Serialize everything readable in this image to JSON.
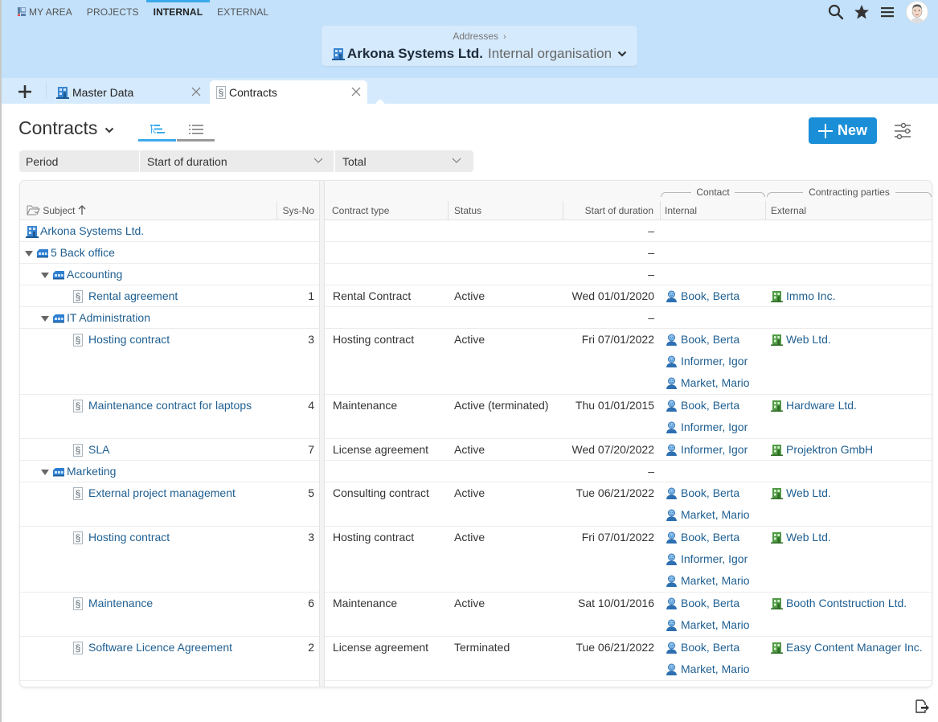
{
  "main_nav": [
    {
      "label": "MY AREA",
      "icon": "my-area-icon"
    },
    {
      "label": "PROJECTS"
    },
    {
      "label": "INTERNAL",
      "active": true
    },
    {
      "label": "EXTERNAL"
    }
  ],
  "tools": {
    "search": "search-icon",
    "favorites": "star-icon",
    "menu": "menu-icon",
    "avatar": "user-avatar"
  },
  "breadcrumb": {
    "parent": "Addresses",
    "separator": "›",
    "org_name": "Arkona Systems Ltd.",
    "org_type": "Internal organisation"
  },
  "tabs": [
    {
      "label": "Master Data",
      "icon": "building-icon"
    },
    {
      "label": "Contracts",
      "icon": "paragraph-icon",
      "active": true
    }
  ],
  "page": {
    "title": "Contracts",
    "new_label": "New"
  },
  "view_modes": [
    {
      "name": "tree-view",
      "active": true
    },
    {
      "name": "list-view",
      "active": false
    }
  ],
  "filters": {
    "period_label": "Period",
    "period_value": "Start of duration",
    "range_value": "Total"
  },
  "columns": {
    "subject": "Subject",
    "sys_no": "Sys-No",
    "contract_type": "Contract type",
    "status": "Status",
    "start": "Start of duration",
    "internal": "Internal",
    "external": "External",
    "group_contact": "Contact",
    "group_parties": "Contracting parties"
  },
  "rows": [
    {
      "kind": "org",
      "level": 0,
      "subject": "Arkona Systems Ltd.",
      "start": "–"
    },
    {
      "kind": "unit",
      "level": 1,
      "subject": "5 Back office",
      "start": "–"
    },
    {
      "kind": "unit",
      "level": 2,
      "subject": "Accounting",
      "start": "–"
    },
    {
      "kind": "contract",
      "level": 3,
      "subject": "Rental agreement",
      "sys_no": "1",
      "type": "Rental Contract",
      "status": "Active",
      "start": "Wed 01/01/2020",
      "internal": [
        "Book, Berta"
      ],
      "external": [
        "Immo Inc."
      ]
    },
    {
      "kind": "unit",
      "level": 2,
      "subject": "IT Administration",
      "start": "–"
    },
    {
      "kind": "contract",
      "level": 3,
      "subject": "Hosting contract",
      "sys_no": "3",
      "type": "Hosting contract",
      "status": "Active",
      "start": "Fri 07/01/2022",
      "internal": [
        "Book, Berta",
        "Informer, Igor",
        "Market, Mario"
      ],
      "external": [
        "Web Ltd."
      ]
    },
    {
      "kind": "contract",
      "level": 3,
      "subject": "Maintenance contract for laptops",
      "sys_no": "4",
      "type": "Maintenance",
      "status": "Active (terminated)",
      "start": "Thu 01/01/2015",
      "internal": [
        "Book, Berta",
        "Informer, Igor"
      ],
      "external": [
        "Hardware Ltd."
      ]
    },
    {
      "kind": "contract",
      "level": 3,
      "subject": "SLA",
      "sys_no": "7",
      "type": "License agreement",
      "status": "Active",
      "start": "Wed 07/20/2022",
      "internal": [
        "Informer, Igor"
      ],
      "external": [
        "Projektron GmbH"
      ]
    },
    {
      "kind": "unit",
      "level": 2,
      "subject": "Marketing",
      "start": "–"
    },
    {
      "kind": "contract",
      "level": 3,
      "subject": "External project management",
      "sys_no": "5",
      "type": "Consulting contract",
      "status": "Active",
      "start": "Tue 06/21/2022",
      "internal": [
        "Book, Berta",
        "Market, Mario"
      ],
      "external": [
        "Web Ltd."
      ]
    },
    {
      "kind": "contract",
      "level": 3,
      "subject": "Hosting contract",
      "sys_no": "3",
      "type": "Hosting contract",
      "status": "Active",
      "start": "Fri 07/01/2022",
      "internal": [
        "Book, Berta",
        "Informer, Igor",
        "Market, Mario"
      ],
      "external": [
        "Web Ltd."
      ]
    },
    {
      "kind": "contract",
      "level": 3,
      "subject": "Maintenance",
      "sys_no": "6",
      "type": "Maintenance",
      "status": "Active",
      "start": "Sat 10/01/2016",
      "internal": [
        "Book, Berta",
        "Market, Mario"
      ],
      "external": [
        "Booth Contstruction Ltd."
      ]
    },
    {
      "kind": "contract",
      "level": 3,
      "subject": "Software Licence Agreement",
      "sys_no": "2",
      "type": "License agreement",
      "status": "Terminated",
      "start": "Tue 06/21/2022",
      "internal": [
        "Book, Berta",
        "Market, Mario"
      ],
      "external": [
        "Easy Content Manager Inc."
      ]
    }
  ],
  "colors": {
    "accent": "#3aa9ea",
    "primary_button": "#1a8fd8",
    "link": "#1f5f91",
    "header_bg": "#c3e1fb",
    "tabbar_bg": "#d5eafc"
  }
}
